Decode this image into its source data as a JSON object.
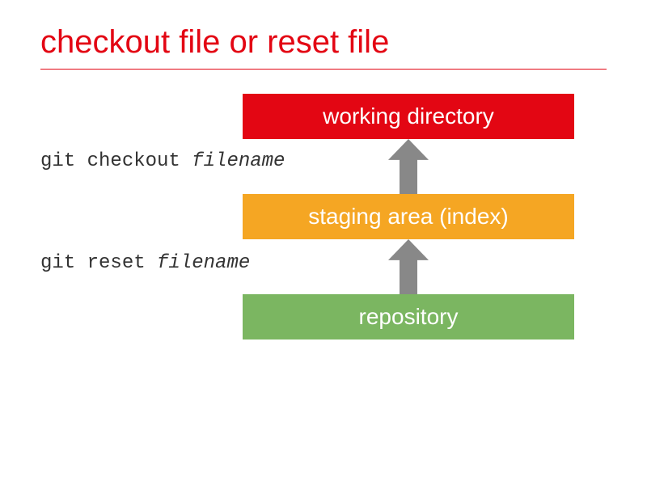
{
  "title": "checkout file or reset file",
  "boxes": {
    "working": "working directory",
    "staging": "staging area (index)",
    "repo": "repository"
  },
  "commands": {
    "checkout": {
      "cmd": "git checkout ",
      "arg": "filename"
    },
    "reset": {
      "cmd": "git reset ",
      "arg": "filename"
    }
  }
}
